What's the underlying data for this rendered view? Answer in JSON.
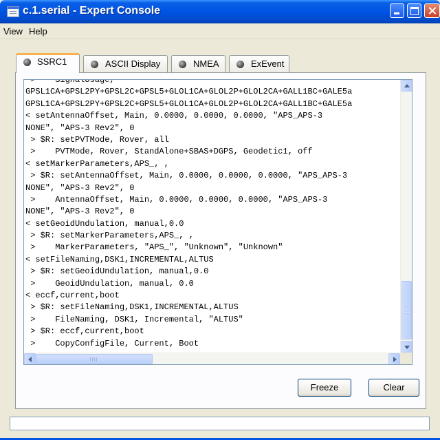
{
  "window": {
    "title": "c.1.serial - Expert Console"
  },
  "menu": {
    "items": [
      "View",
      "Help"
    ]
  },
  "tabs": [
    {
      "label": "SSRC1",
      "active": true
    },
    {
      "label": "ASCII Display",
      "active": false
    },
    {
      "label": "NMEA",
      "active": false
    },
    {
      "label": "ExEvent",
      "active": false
    }
  ],
  "console": {
    "lines": [
      " >    SignalUsage,",
      "GPSL1CA+GPSL2PY+GPSL2C+GPSL5+GLOL1CA+GLOL2P+GLOL2CA+GALL1BC+GALE5a",
      "GPSL1CA+GPSL2PY+GPSL2C+GPSL5+GLOL1CA+GLOL2P+GLOL2CA+GALL1BC+GALE5a",
      "< setAntennaOffset, Main, 0.0000, 0.0000, 0.0000, \"APS_APS-3",
      "NONE\", \"APS-3 Rev2\", 0",
      " > $R: setPVTMode, Rover, all",
      " >    PVTMode, Rover, StandAlone+SBAS+DGPS, Geodetic1, off",
      "< setMarkerParameters,APS_, ,",
      " > $R: setAntennaOffset, Main, 0.0000, 0.0000, 0.0000, \"APS_APS-3",
      "NONE\", \"APS-3 Rev2\", 0",
      " >    AntennaOffset, Main, 0.0000, 0.0000, 0.0000, \"APS_APS-3",
      "NONE\", \"APS-3 Rev2\", 0",
      "< setGeoidUndulation, manual,0.0",
      " > $R: setMarkerParameters,APS_, ,",
      " >    MarkerParameters, \"APS_\", \"Unknown\", \"Unknown\"",
      "< setFileNaming,DSK1,INCREMENTAL,ALTUS",
      " > $R: setGeoidUndulation, manual,0.0",
      " >    GeoidUndulation, manual, 0.0",
      "< eccf,current,boot",
      " > $R: setFileNaming,DSK1,INCREMENTAL,ALTUS",
      " >    FileNaming, DSK1, Incremental, \"ALTUS\"",
      " > $R: eccf,current,boot",
      " >    CopyConfigFile, Current, Boot"
    ]
  },
  "buttons": {
    "freeze": "Freeze",
    "clear": "Clear"
  },
  "status": {
    "text": ""
  },
  "colors": {
    "titlebar": "#0054e3",
    "active_tab_accent": "#f6b14a",
    "window_bg": "#ece9d8"
  }
}
